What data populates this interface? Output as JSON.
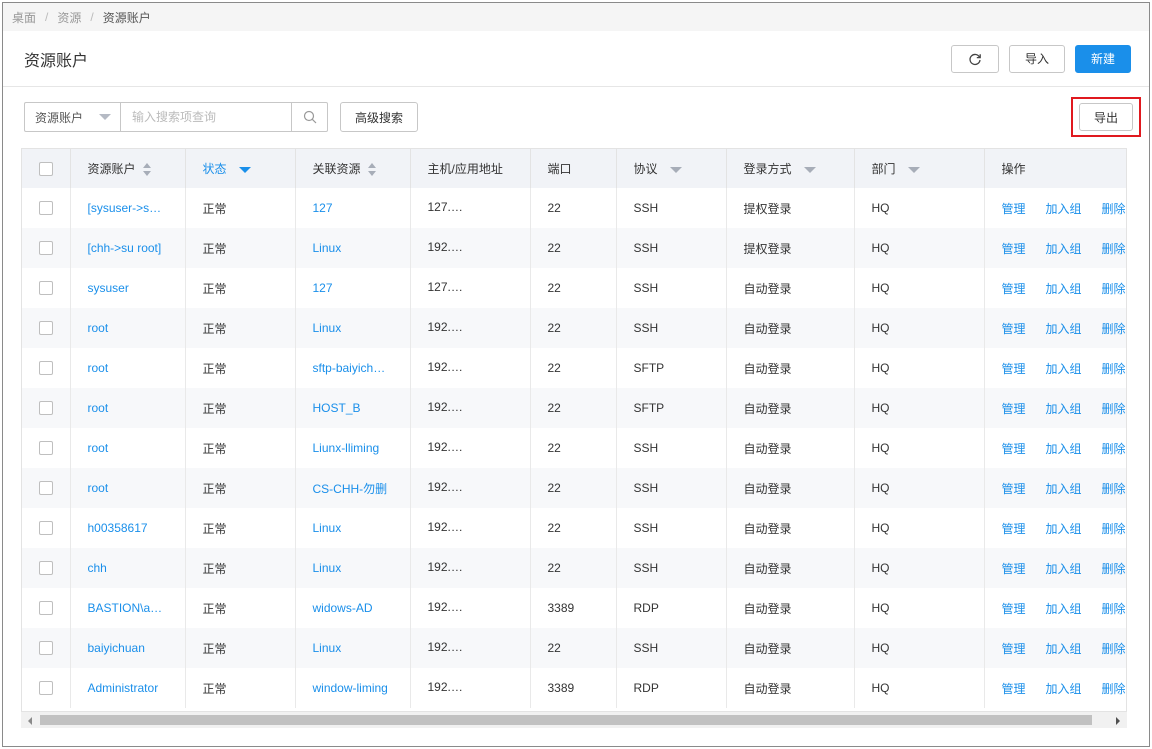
{
  "breadcrumb": [
    "桌面",
    "资源",
    "资源账户"
  ],
  "page": {
    "title": "资源账户",
    "refresh_icon": "refresh-icon",
    "import_label": "导入",
    "new_label": "新建"
  },
  "toolbar": {
    "search_field": "资源账户",
    "search_placeholder": "输入搜索项查询",
    "search_icon": "search-icon",
    "advanced_label": "高级搜索",
    "export_label": "导出"
  },
  "colors": {
    "accent": "#1a8fea",
    "highlight_box": "#e0191f"
  },
  "table": {
    "columns": [
      "资源账户",
      "状态",
      "关联资源",
      "主机/应用地址",
      "端口",
      "协议",
      "登录方式",
      "部门",
      "操作"
    ],
    "actions": [
      "管理",
      "加入组",
      "删除"
    ],
    "rows": [
      {
        "account": "[sysuser->s…",
        "status": "正常",
        "resource": "127",
        "address": "127.",
        "port": "22",
        "protocol": "SSH",
        "login": "提权登录",
        "dept": "HQ"
      },
      {
        "account": "[chh->su root]",
        "status": "正常",
        "resource": "Linux",
        "address": "192.",
        "port": "22",
        "protocol": "SSH",
        "login": "提权登录",
        "dept": "HQ"
      },
      {
        "account": "sysuser",
        "status": "正常",
        "resource": "127",
        "address": "127.",
        "port": "22",
        "protocol": "SSH",
        "login": "自动登录",
        "dept": "HQ"
      },
      {
        "account": "root",
        "status": "正常",
        "resource": "Linux",
        "address": "192.",
        "port": "22",
        "protocol": "SSH",
        "login": "自动登录",
        "dept": "HQ"
      },
      {
        "account": "root",
        "status": "正常",
        "resource": "sftp-baiyich…",
        "address": "192.",
        "port": "22",
        "protocol": "SFTP",
        "login": "自动登录",
        "dept": "HQ"
      },
      {
        "account": "root",
        "status": "正常",
        "resource": "HOST_B",
        "address": "192.",
        "port": "22",
        "protocol": "SFTP",
        "login": "自动登录",
        "dept": "HQ"
      },
      {
        "account": "root",
        "status": "正常",
        "resource": "Liunx-lliming",
        "address": "192.",
        "port": "22",
        "protocol": "SSH",
        "login": "自动登录",
        "dept": "HQ"
      },
      {
        "account": "root",
        "status": "正常",
        "resource": "CS-CHH-勿删",
        "address": "192.",
        "port": "22",
        "protocol": "SSH",
        "login": "自动登录",
        "dept": "HQ"
      },
      {
        "account": "h00358617",
        "status": "正常",
        "resource": "Linux",
        "address": "192.",
        "port": "22",
        "protocol": "SSH",
        "login": "自动登录",
        "dept": "HQ"
      },
      {
        "account": "chh",
        "status": "正常",
        "resource": "Linux",
        "address": "192.",
        "port": "22",
        "protocol": "SSH",
        "login": "自动登录",
        "dept": "HQ"
      },
      {
        "account": "BASTION\\a…",
        "status": "正常",
        "resource": "widows-AD",
        "address": "192.",
        "port": "3389",
        "protocol": "RDP",
        "login": "自动登录",
        "dept": "HQ"
      },
      {
        "account": "baiyichuan",
        "status": "正常",
        "resource": "Linux",
        "address": "192.",
        "port": "22",
        "protocol": "SSH",
        "login": "自动登录",
        "dept": "HQ"
      },
      {
        "account": "Administrator",
        "status": "正常",
        "resource": "window-liming",
        "address": "192.",
        "port": "3389",
        "protocol": "RDP",
        "login": "自动登录",
        "dept": "HQ"
      }
    ]
  }
}
